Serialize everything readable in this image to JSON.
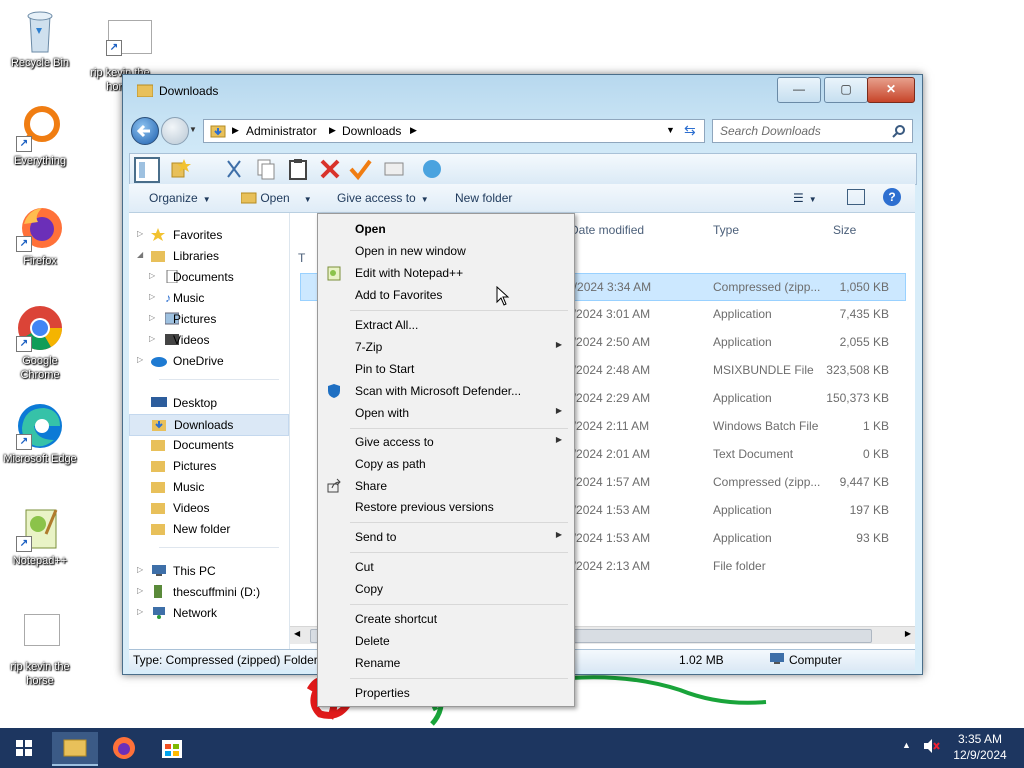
{
  "desktop": {
    "icons": [
      {
        "label": "Recycle Bin"
      },
      {
        "label": "rip kevin the horse"
      },
      {
        "label": "Everything"
      },
      {
        "label": "Firefox"
      },
      {
        "label": "Google Chrome"
      },
      {
        "label": "Microsoft Edge"
      },
      {
        "label": "Notepad++"
      },
      {
        "label": "rip kevin the horse"
      }
    ]
  },
  "window": {
    "title": "Downloads",
    "buttons": {
      "minimize": "—",
      "maximize": "▢",
      "close": "✕"
    },
    "address": {
      "crumbs": [
        "Administrator",
        "Downloads"
      ]
    },
    "search": {
      "placeholder": "Search Downloads"
    },
    "toolbar": {
      "organize": "Organize",
      "open": "Open",
      "give_access": "Give access to",
      "new_folder": "New folder"
    },
    "nav": {
      "items": [
        {
          "label": "Favorites"
        },
        {
          "label": "Libraries"
        },
        {
          "label": "Documents"
        },
        {
          "label": "Music"
        },
        {
          "label": "Pictures"
        },
        {
          "label": "Videos"
        },
        {
          "label": "OneDrive"
        },
        {
          "label": "Desktop"
        },
        {
          "label": "Downloads"
        },
        {
          "label": "Documents"
        },
        {
          "label": "Pictures"
        },
        {
          "label": "Music"
        },
        {
          "label": "Videos"
        },
        {
          "label": "New folder"
        },
        {
          "label": "This PC"
        },
        {
          "label": "thescuffmini (D:)"
        },
        {
          "label": "Network"
        }
      ]
    },
    "columns": {
      "date": "Date modified",
      "type": "Type",
      "size": "Size",
      "group_initial": "T"
    },
    "files": [
      {
        "date": "2/9/2024 3:34 AM",
        "type": "Compressed (zipp...",
        "size": "1,050 KB"
      },
      {
        "date": "2/9/2024 3:01 AM",
        "type": "Application",
        "size": "7,435 KB"
      },
      {
        "date": "2/9/2024 2:50 AM",
        "type": "Application",
        "size": "2,055 KB"
      },
      {
        "date": "2/9/2024 2:48 AM",
        "type": "MSIXBUNDLE File",
        "size": "323,508 KB"
      },
      {
        "date": "2/9/2024 2:29 AM",
        "type": "Application",
        "size": "150,373 KB"
      },
      {
        "date": "2/9/2024 2:11 AM",
        "type": "Windows Batch File",
        "size": "1 KB"
      },
      {
        "date": "2/9/2024 2:01 AM",
        "type": "Text Document",
        "size": "0 KB"
      },
      {
        "date": "2/9/2024 1:57 AM",
        "type": "Compressed (zipp...",
        "size": "9,447 KB"
      },
      {
        "date": "2/9/2024 1:53 AM",
        "type": "Application",
        "size": "197 KB"
      },
      {
        "date": "2/9/2024 1:53 AM",
        "type": "Application",
        "size": "93 KB"
      },
      {
        "date": "2/9/2024 2:13 AM",
        "type": "File folder",
        "size": ""
      }
    ],
    "status": {
      "left": "Type: Compressed (zipped) Folder,",
      "size": "1.02 MB",
      "location": "Computer"
    }
  },
  "context_menu": {
    "items": [
      {
        "label": "Open"
      },
      {
        "label": "Open in new window"
      },
      {
        "label": "Edit with Notepad++"
      },
      {
        "label": "Add to Favorites"
      },
      {
        "label": "Extract All..."
      },
      {
        "label": "7-Zip"
      },
      {
        "label": "Pin to Start"
      },
      {
        "label": "Scan with Microsoft Defender..."
      },
      {
        "label": "Open with"
      },
      {
        "label": "Give access to"
      },
      {
        "label": "Copy as path"
      },
      {
        "label": "Share"
      },
      {
        "label": "Restore previous versions"
      },
      {
        "label": "Send to"
      },
      {
        "label": "Cut"
      },
      {
        "label": "Copy"
      },
      {
        "label": "Create shortcut"
      },
      {
        "label": "Delete"
      },
      {
        "label": "Rename"
      },
      {
        "label": "Properties"
      }
    ]
  },
  "taskbar": {
    "time": "3:35 AM",
    "date": "12/9/2024"
  },
  "colors": {
    "taskbar": "#1d3660",
    "selection": "#cce8ff",
    "accent": "#1e395b"
  }
}
